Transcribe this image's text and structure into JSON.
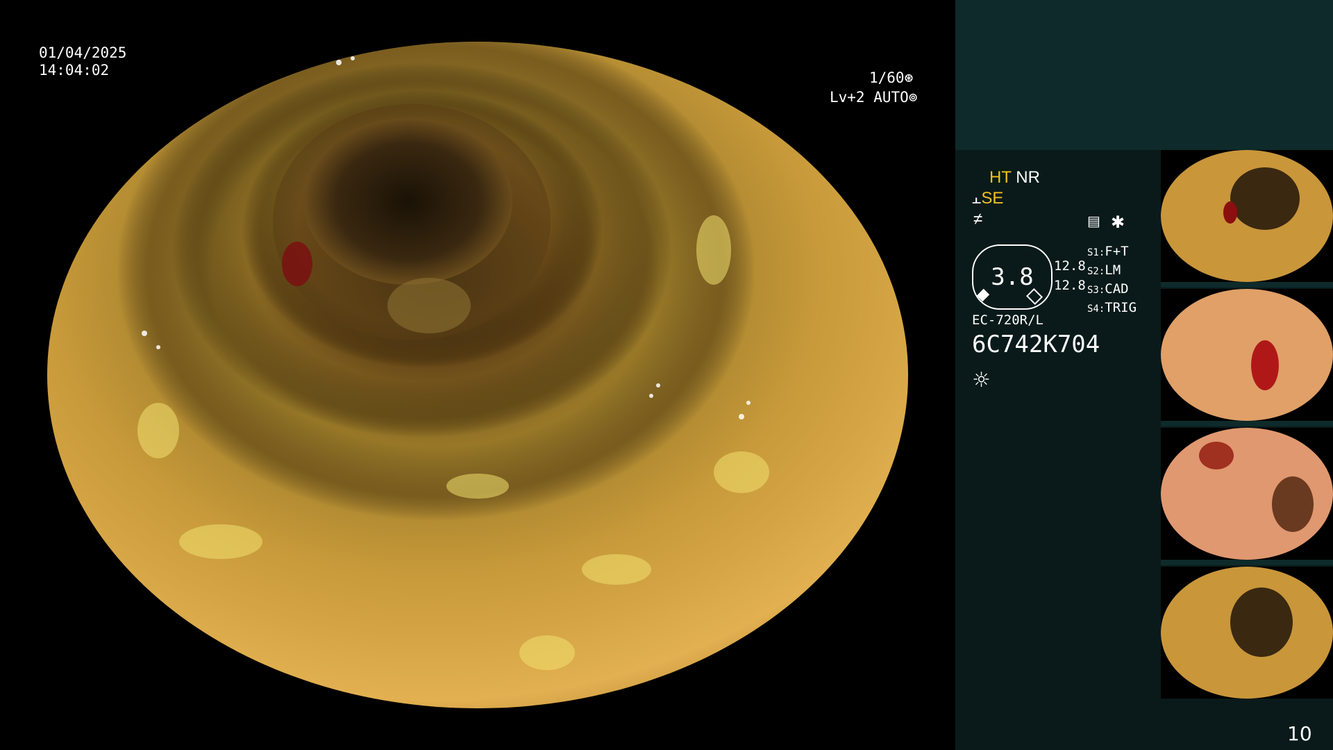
{
  "overlay": {
    "date": "01/04/2025",
    "time": "14:04:02",
    "shutter": "1/60",
    "level": "Lv+2 AUTO",
    "shutter_icon": "aperture-icon",
    "auto_icon": "auto-exposure-icon"
  },
  "panel": {
    "ht": "HT",
    "nr": "NR",
    "se": "SE",
    "zoom_value": "3.8",
    "zoom_left_top": "12.8",
    "zoom_left_bottom": "12.8",
    "switches": [
      {
        "key": "S1:",
        "value": "F+T"
      },
      {
        "key": "S2:",
        "value": "LM"
      },
      {
        "key": "S3:",
        "value": "CAD"
      },
      {
        "key": "S4:",
        "value": "TRIG"
      }
    ],
    "scope_model": "EC-720R/L",
    "serial": "6C742K704",
    "page_number": "10"
  },
  "colors": {
    "panel_bg": "#0a1a1a",
    "panel_top": "#0e2a2a",
    "accent_yellow": "#f0c020"
  }
}
